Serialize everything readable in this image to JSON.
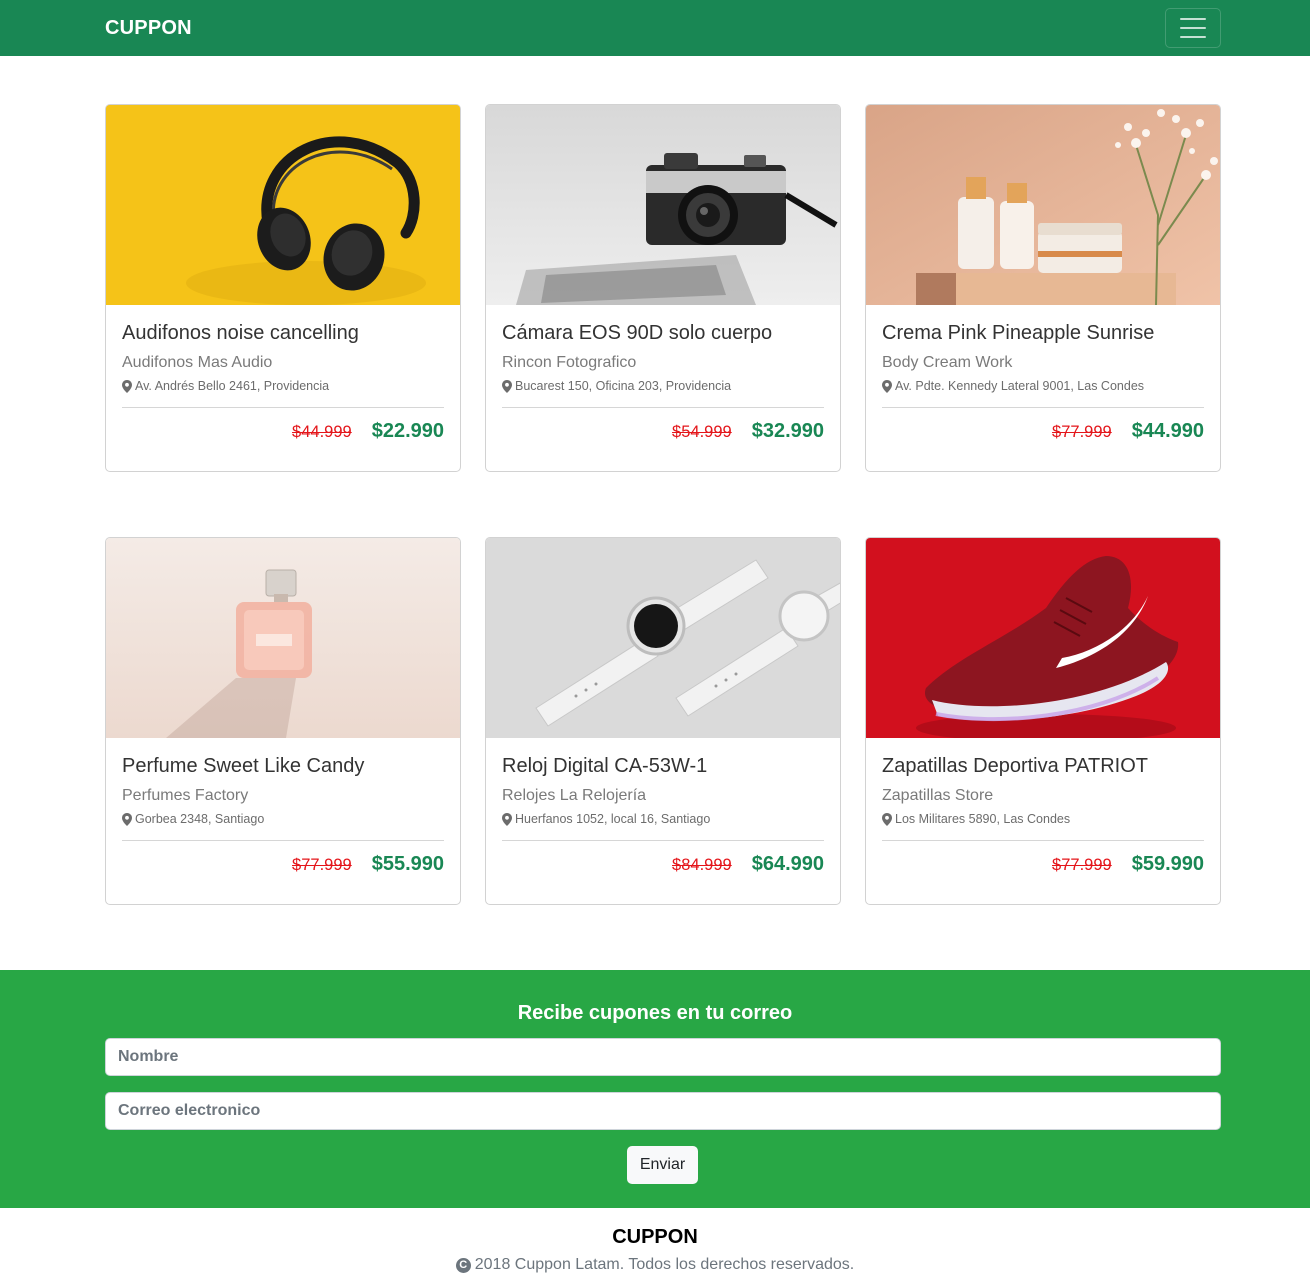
{
  "navbar": {
    "brand": "CUPPON",
    "menu_icon": "hamburger-menu-icon"
  },
  "colors": {
    "primary": "#198754",
    "subscribe_bg": "#28a745",
    "old_price": "#e4151a"
  },
  "products": [
    {
      "title": "Audifonos noise cancelling",
      "store": "Audifonos Mas Audio",
      "address": "Av. Andrés Bello 2461, Providencia",
      "old_price": "$44.999",
      "price": "$22.990",
      "image": "headphones-image"
    },
    {
      "title": "Cámara EOS 90D solo cuerpo",
      "store": "Rincon Fotografico",
      "address": "Bucarest 150, Oficina 203, Providencia",
      "old_price": "$54.999",
      "price": "$32.990",
      "image": "camera-image"
    },
    {
      "title": "Crema Pink Pineapple Sunrise",
      "store": "Body Cream Work",
      "address": "Av. Pdte. Kennedy Lateral 9001, Las Condes",
      "old_price": "$77.999",
      "price": "$44.990",
      "image": "cream-image"
    },
    {
      "title": "Perfume Sweet Like Candy",
      "store": "Perfumes Factory",
      "address": "Gorbea 2348, Santiago",
      "old_price": "$77.999",
      "price": "$55.990",
      "image": "perfume-image"
    },
    {
      "title": "Reloj Digital CA-53W-1",
      "store": "Relojes La Relojería",
      "address": "Huerfanos 1052, local 16, Santiago",
      "old_price": "$84.999",
      "price": "$64.990",
      "image": "watch-image"
    },
    {
      "title": "Zapatillas Deportiva PATRIOT",
      "store": "Zapatillas Store",
      "address": "Los Militares 5890, Las Condes",
      "old_price": "$77.999",
      "price": "$59.990",
      "image": "sneaker-image"
    }
  ],
  "subscribe": {
    "title": "Recibe cupones en tu correo",
    "name_placeholder": "Nombre",
    "email_placeholder": "Correo electronico",
    "submit_label": "Enviar"
  },
  "footer": {
    "brand": "CUPPON",
    "copyright_symbol": "C",
    "copyright": "2018 Cuppon Latam. Todos los derechos reservados."
  }
}
